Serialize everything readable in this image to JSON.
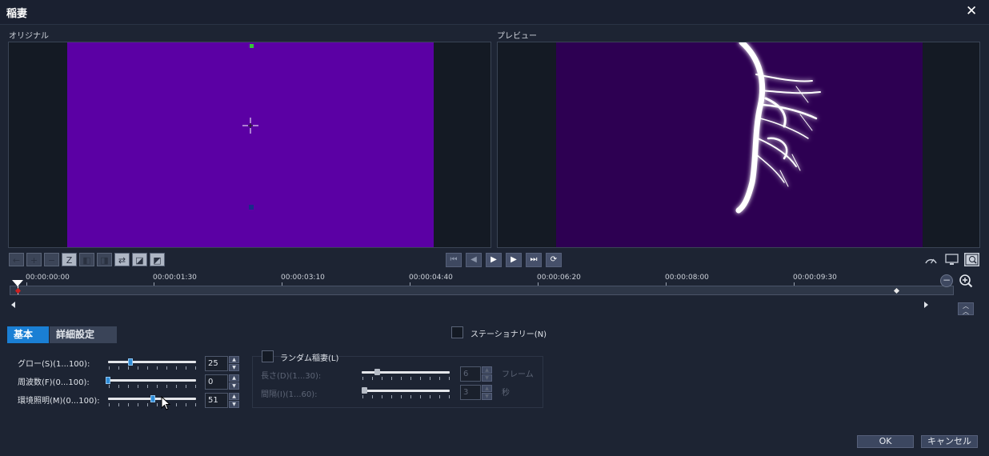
{
  "dialog": {
    "title": "稲妻",
    "close_glyph": "✕"
  },
  "panes": {
    "original_label": "オリジナル",
    "preview_label": "プレビュー"
  },
  "colors": {
    "original_bg": "#5b00a4",
    "preview_bg": "#2d0052",
    "accent": "#1a7fd4"
  },
  "toolbar_left": {
    "buttons": [
      {
        "name": "arrow-left-icon",
        "glyph": "←"
      },
      {
        "name": "plus-icon",
        "glyph": "+"
      },
      {
        "name": "minus-icon",
        "glyph": "−"
      },
      {
        "name": "no-keyframe-icon",
        "glyph": "Z"
      },
      {
        "name": "prev-keyframe-icon",
        "glyph": "◧"
      },
      {
        "name": "next-keyframe-icon",
        "glyph": "◨"
      },
      {
        "name": "reverse-icon",
        "glyph": "⇄"
      },
      {
        "name": "copy-keyframe-icon",
        "glyph": "◪"
      },
      {
        "name": "paste-keyframe-icon",
        "glyph": "◩"
      }
    ]
  },
  "playback": {
    "buttons": [
      {
        "name": "go-start-icon",
        "glyph": "⏮"
      },
      {
        "name": "prev-frame-icon",
        "glyph": "◀"
      },
      {
        "name": "play-icon",
        "glyph": "▶"
      },
      {
        "name": "next-frame-icon",
        "glyph": "▶"
      },
      {
        "name": "go-end-icon",
        "glyph": "⏭"
      },
      {
        "name": "loop-icon",
        "glyph": "⟳"
      }
    ]
  },
  "right_tools": [
    "speedometer-icon",
    "monitor-icon",
    "zoom-preview-icon"
  ],
  "timeline": {
    "timecodes": [
      "00:00:00:00",
      "00:00:01:30",
      "00:00:03:10",
      "00:00:04:40",
      "00:00:06:20",
      "00:00:08:00",
      "00:00:09:30"
    ]
  },
  "tabs": {
    "basic": "基本",
    "advanced": "詳細設定"
  },
  "stationary": {
    "label": "ステーショナリー(N)",
    "checked": false
  },
  "settings": [
    {
      "label": "グロー(S)(1...100):",
      "value": "25",
      "fraction": 0.25
    },
    {
      "label": "周波数(F)(0...100):",
      "value": "0",
      "fraction": 0.0
    },
    {
      "label": "環境照明(M)(0...100):",
      "value": "51",
      "fraction": 0.51
    }
  ],
  "random_lightning": {
    "label": "ランダム稲妻(L)",
    "checked": false,
    "rows": [
      {
        "label": "長さ(D)(1...30):",
        "value": "6",
        "unit": "フレーム",
        "fraction": 0.17
      },
      {
        "label": "間隔(I)(1...60):",
        "value": "3",
        "unit": "秒",
        "fraction": 0.03
      }
    ]
  },
  "footer": {
    "ok": "OK",
    "cancel": "キャンセル"
  }
}
